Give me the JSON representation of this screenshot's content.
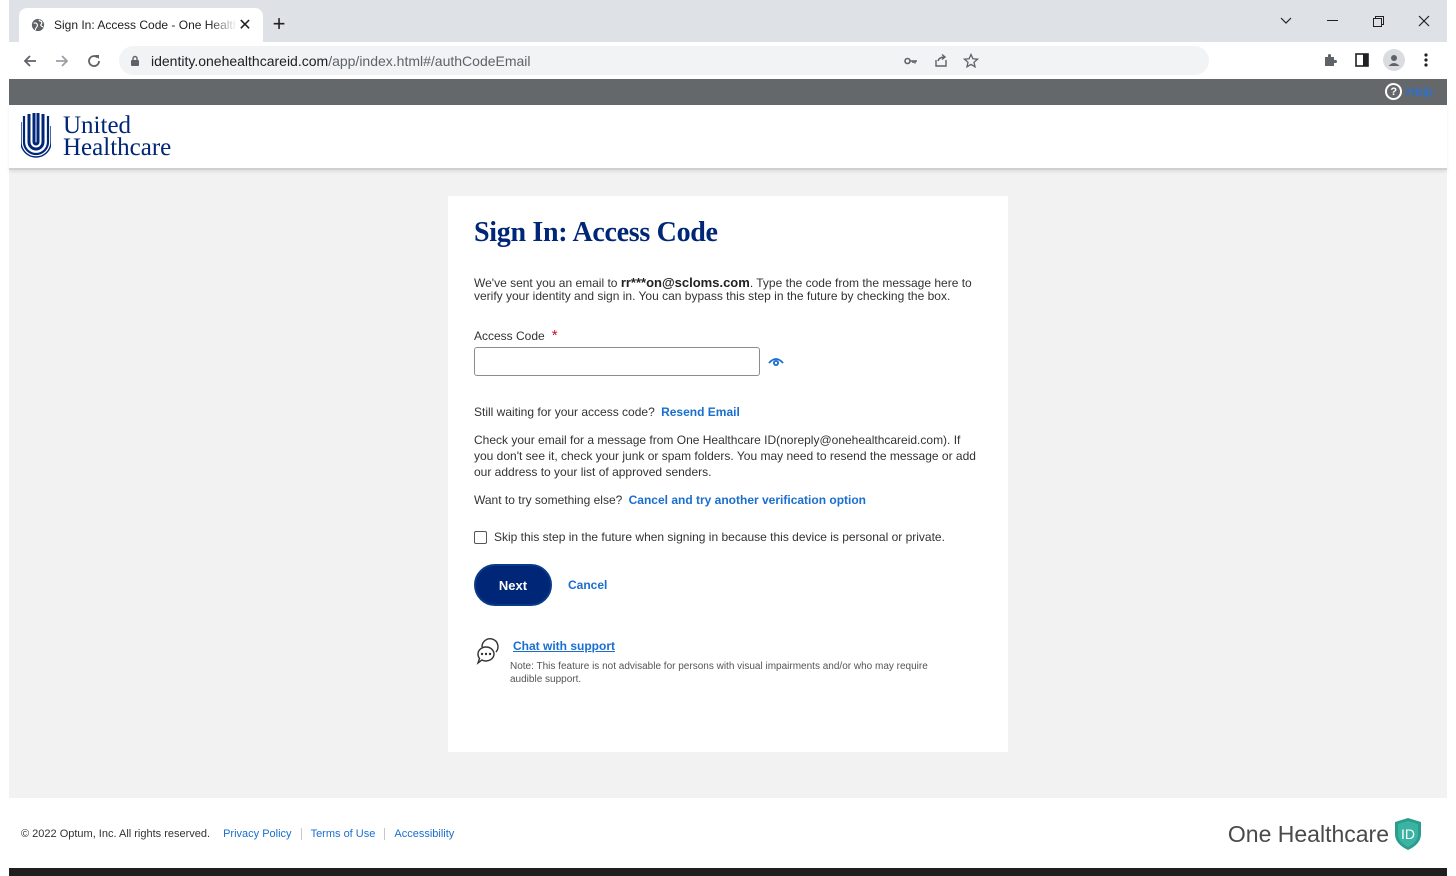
{
  "browser": {
    "tab_title": "Sign In: Access Code - One Healthcare ID",
    "tab_close": "✕",
    "new_tab": "+",
    "url_host": "identity.onehealthcareid.com",
    "url_path": "/app/index.html#/authCodeEmail",
    "window_controls": [
      "chevron-down-icon",
      "minimize-icon",
      "restore-icon",
      "close-icon"
    ]
  },
  "utility_bar": {
    "help_label": "Help"
  },
  "brand": {
    "line1": "United",
    "line2": "Healthcare",
    "color": "#002677"
  },
  "signin": {
    "title": "Sign In: Access Code",
    "intro_before": "We've sent you an email to ",
    "email": "rr***on@scloms.com",
    "intro_after": ". Type the code from the message here to verify your identity and sign in. You can bypass this step in the future by checking the box.",
    "access_code_label": "Access Code",
    "required_mark": "*",
    "access_code_value": "",
    "waiting_text": "Still waiting for your access code?",
    "resend_link": "Resend Email",
    "check_email_text": "Check your email for a message from One Healthcare ID(noreply@onehealthcareid.com). If you don't see it, check your junk or spam folders. You may need to resend the message or add our address to your list of approved senders.",
    "try_else_text": "Want to try something else?",
    "try_else_link": "Cancel and try another verification option",
    "skip_label": "Skip this step in the future when signing in because this device is personal or private.",
    "skip_checked": false,
    "next_button": "Next",
    "cancel_button": "Cancel",
    "chat_link": "Chat with support",
    "chat_note": "Note: This feature is not advisable for persons with visual impairments and/or who may require audible support."
  },
  "footer": {
    "copyright": "© 2022 Optum, Inc. All rights reserved.",
    "links": [
      "Privacy Policy",
      "Terms of Use",
      "Accessibility"
    ],
    "logo_text": "One Healthcare",
    "logo_badge": "ID"
  },
  "colors": {
    "navy": "#002677",
    "link": "#196ecf",
    "required": "#c8102e",
    "teal": "#2a9d8f"
  }
}
